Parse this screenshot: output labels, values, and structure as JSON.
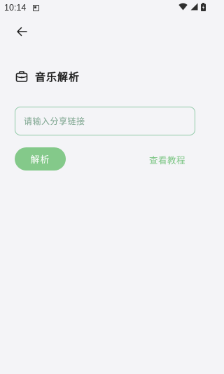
{
  "status_bar": {
    "time": "10:14"
  },
  "header": {
    "back_icon": "arrow-left-icon",
    "title": "音乐解析",
    "title_icon": "briefcase-icon"
  },
  "form": {
    "input_placeholder": "请输入分享链接",
    "input_value": "",
    "parse_label": "解析",
    "tutorial_label": "查看教程"
  },
  "colors": {
    "accent": "#84c98a",
    "input_border": "#8fc9a6",
    "background": "#f4f4f7"
  }
}
